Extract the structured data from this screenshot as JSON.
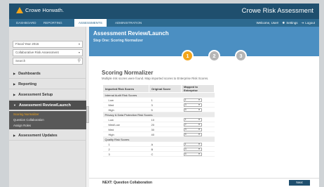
{
  "brand": {
    "logo_text": "Crowe Horwath.",
    "app_title": "Crowe Risk Assessment",
    "accent": "#f3a51b",
    "header_color": "#1f4f6e"
  },
  "nav": {
    "tabs": [
      "DASHBOARD",
      "REPORTING",
      "ASSESSMENTS",
      "ADMINISTRATION"
    ],
    "active": "ASSESSMENTS"
  },
  "user": {
    "welcome": "Welcome, User!",
    "settings": "Settings",
    "logout": "Logout"
  },
  "sidebar": {
    "fiscal_year": "Fiscal Year 2016",
    "assessment": "Collaborative Risk Assessment",
    "search_placeholder": "Search",
    "items": [
      "Dashboards",
      "Reporting",
      "Assessment Setup",
      "Assessment Review/Launch",
      "Assessment Updates"
    ],
    "subitems": [
      "Scoring Normalizer",
      "Question Collaboration",
      "Assign Roles"
    ]
  },
  "banner": {
    "title": "Assessment Review/Launch",
    "subtitle": "Step One: Scoring Normalizer"
  },
  "steps": [
    "1",
    "2",
    "3"
  ],
  "main": {
    "title": "Scoring Normalizer",
    "description": "Multiple risk scores were found. Map imported scores to Enterprise Risk Scores.",
    "columns": [
      "Imported Risk Scores",
      "Original Score",
      "Mapped to Enterprise"
    ],
    "groups": [
      {
        "name": "Internal Audit Risk Scores",
        "rows": [
          {
            "label": "Low",
            "original": "1",
            "mapped": "1"
          },
          {
            "label": "Med",
            "original": "3",
            "mapped": "3"
          },
          {
            "label": "High",
            "original": "5",
            "mapped": "5"
          }
        ]
      },
      {
        "name": "Privacy & Data Protection Risk Scores",
        "rows": [
          {
            "label": "Low",
            "original": "10",
            "mapped": "1"
          },
          {
            "label": "Med/Low",
            "original": "20",
            "mapped": "2"
          },
          {
            "label": "Med",
            "original": "30",
            "mapped": "3"
          },
          {
            "label": "High",
            "original": "40",
            "mapped": "5"
          }
        ]
      },
      {
        "name": "Quality Risk Scores",
        "rows": [
          {
            "label": "1",
            "original": "A",
            "mapped": "1"
          },
          {
            "label": "2",
            "original": "B",
            "mapped": "3"
          },
          {
            "label": "3",
            "original": "C",
            "mapped": "5"
          }
        ]
      }
    ]
  },
  "footer": {
    "next_label": "NEXT: Question Collaboration",
    "next_button": "Next"
  }
}
